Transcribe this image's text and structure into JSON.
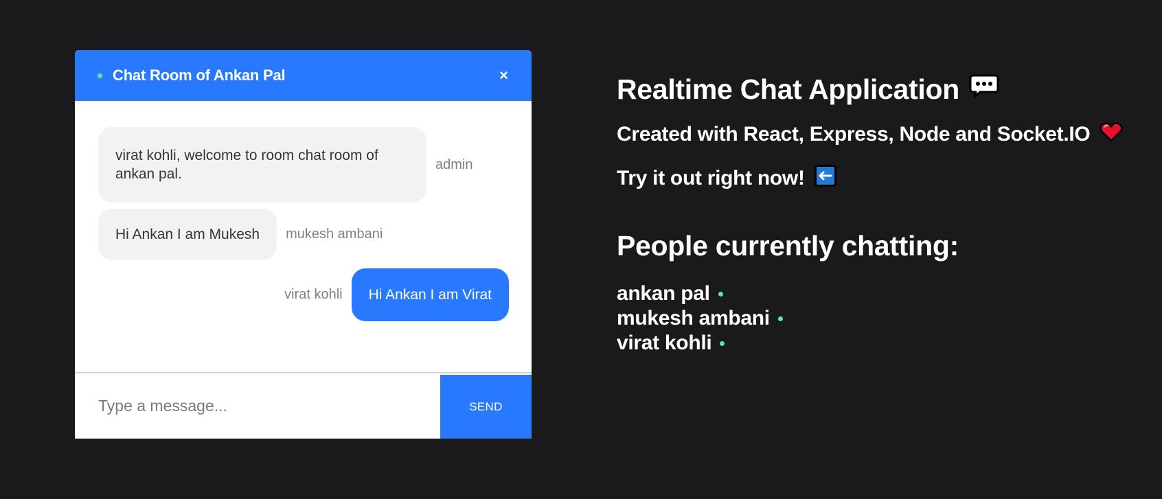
{
  "chat": {
    "title": "Chat Room of Ankan Pal",
    "close_icon": "×",
    "messages": [
      {
        "text": "virat kohli, welcome to room chat room of ankan pal.",
        "sender": "admin",
        "side": "left"
      },
      {
        "text": "Hi Ankan I am Mukesh",
        "sender": "mukesh ambani",
        "side": "left"
      },
      {
        "text": "Hi Ankan I am Virat",
        "sender": "virat kohli",
        "side": "right"
      }
    ],
    "input_placeholder": "Type a message...",
    "input_value": "",
    "send_label": "SEND"
  },
  "info": {
    "title": "Realtime Chat Application",
    "title_icon": "speech-balloon-icon",
    "subtitle": "Created with React, Express, Node and Socket.IO",
    "subtitle_icon": "heart-icon",
    "try_text": "Try it out right now!",
    "try_icon": "left-arrow-icon",
    "people_title": "People currently chatting:",
    "people": [
      "ankan pal",
      "mukesh ambani",
      "virat kohli"
    ]
  },
  "colors": {
    "background": "#1a1a1d",
    "accent": "#2979ff",
    "online": "#5de3b0",
    "bubble_grey": "#f2f2f2",
    "heart": "#e8112d"
  }
}
